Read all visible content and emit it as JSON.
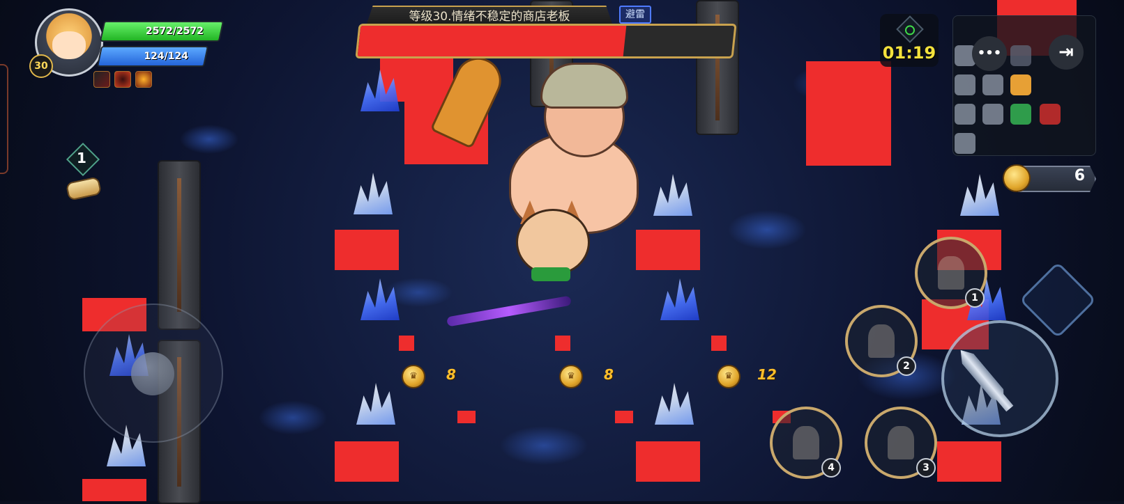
{
  "player": {
    "level": "30",
    "hp_text": "2572/2572",
    "mp_text": "124/124",
    "buff_icons": [
      "blade-buff-icon",
      "fire-ring-buff-icon",
      "flame-mask-buff-icon"
    ]
  },
  "boss": {
    "name": "等级30.情绪不稳定的商店老板",
    "tag": "避雷",
    "hp_fraction": 0.71
  },
  "timer": "01:19",
  "coins": {
    "total": "6"
  },
  "drops": [
    {
      "value": "8"
    },
    {
      "value": "8"
    },
    {
      "value": "12"
    }
  ],
  "quest": {
    "count": "1"
  },
  "menu": {
    "more_label": "•••"
  },
  "skills": [
    {
      "number": "1"
    },
    {
      "number": "2"
    },
    {
      "number": "3"
    },
    {
      "number": "4"
    }
  ],
  "colors": {
    "hp": "#22b524",
    "mp": "#2464d9",
    "boss_hp": "#ee2d2d",
    "timer": "#f4e23c",
    "gold": "#ffbf2b"
  }
}
